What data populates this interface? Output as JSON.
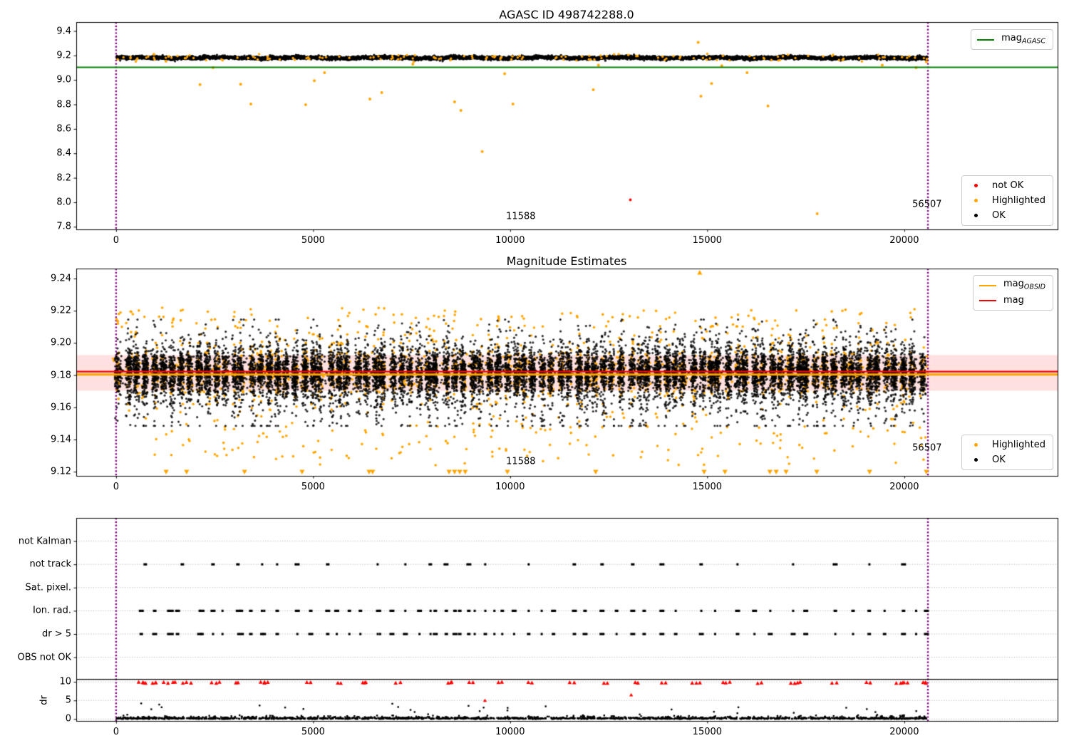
{
  "colors": {
    "ok": "#000000",
    "highlighted": "#FFA500",
    "not_ok": "#FF0000",
    "mag_agasc": "#008000",
    "mag": "#FF0000",
    "mag_obsid": "#FFA500",
    "vline": "#800080",
    "band": "rgba(255,0,0,0.12)",
    "grid": "#b5b5b5",
    "legend_border": "#cccccc"
  },
  "chart_data": [
    {
      "type": "scatter",
      "title": "AGASC ID 498742288.0",
      "xlim": [
        -1010,
        23890
      ],
      "ylim": [
        7.7785,
        9.4728
      ],
      "xticks": [
        0,
        5000,
        10000,
        15000,
        20000
      ],
      "xtick_labels": [
        "0",
        "5000",
        "10000",
        "15000",
        "20000"
      ],
      "yticks": [
        9.4,
        9.2,
        9.0,
        8.8,
        8.6,
        8.4,
        8.2,
        8.0,
        7.8
      ],
      "ytick_labels": [
        "9.4",
        "9.2",
        "9.0",
        "8.8",
        "8.6",
        "8.4",
        "8.2",
        "8.0",
        "7.8"
      ],
      "grid": false,
      "legend_top": [
        {
          "marker": "line",
          "color": "#008000",
          "label": "mag",
          "sub": "AGASC"
        }
      ],
      "legend_bottom": [
        {
          "marker": "dot",
          "color": "#FF0000",
          "label": "not OK"
        },
        {
          "marker": "dot",
          "color": "#FFA500",
          "label": "Highlighted"
        },
        {
          "marker": "dot",
          "color": "#000000",
          "label": "OK"
        }
      ],
      "mag_agasc_line": {
        "y": 9.103,
        "color": "#008000"
      },
      "vlines": [
        0,
        20600
      ],
      "annotations": [
        {
          "text": "11588",
          "x": 10271,
          "y": 7.885
        },
        {
          "text": "56507",
          "x": 20578,
          "y": 7.983
        }
      ],
      "ok_series": {
        "label": "OK",
        "color": "#000000",
        "n": 6500,
        "x_range": [
          20,
          20580
        ],
        "mean": 9.181,
        "sd": 0.0068,
        "clip": [
          9.153,
          9.212
        ]
      },
      "highlighted_series": {
        "label": "Highlighted",
        "color": "#FFA500",
        "n_band": 150,
        "band_sd": 0.013,
        "outliers": [
          [
            960,
            9.21
          ],
          [
            1266,
            9.152
          ],
          [
            2130,
            8.962
          ],
          [
            3160,
            8.965
          ],
          [
            3420,
            8.803
          ],
          [
            4810,
            8.797
          ],
          [
            5030,
            8.994
          ],
          [
            6440,
            8.844
          ],
          [
            6740,
            8.896
          ],
          [
            8590,
            8.82
          ],
          [
            8750,
            8.751
          ],
          [
            9290,
            8.415
          ],
          [
            10070,
            8.803
          ],
          [
            12110,
            8.919
          ],
          [
            14770,
            9.307
          ],
          [
            14840,
            8.867
          ],
          [
            15110,
            8.971
          ],
          [
            15370,
            9.116
          ],
          [
            16540,
            8.787
          ],
          [
            17790,
            7.906
          ],
          [
            2460,
            9.1
          ],
          [
            5290,
            9.06
          ],
          [
            7530,
            9.13
          ],
          [
            9860,
            9.05
          ],
          [
            12240,
            9.12
          ],
          [
            16010,
            9.06
          ],
          [
            19440,
            9.12
          ],
          [
            20300,
            9.1
          ],
          [
            20560,
            9.148
          ]
        ]
      },
      "not_ok_series": {
        "label": "not OK",
        "color": "#FF0000",
        "points": [
          [
            13050,
            8.02
          ]
        ]
      }
    },
    {
      "type": "scatter",
      "title": "Magnitude Estimates",
      "xlim": [
        -1010,
        23890
      ],
      "ylim": [
        9.1174,
        9.2462
      ],
      "xticks": [
        0,
        5000,
        10000,
        15000,
        20000
      ],
      "xtick_labels": [
        "0",
        "5000",
        "10000",
        "15000",
        "20000"
      ],
      "yticks": [
        9.24,
        9.22,
        9.2,
        9.18,
        9.16,
        9.14,
        9.12
      ],
      "ytick_labels": [
        "9.24",
        "9.22",
        "9.20",
        "9.18",
        "9.16",
        "9.14",
        "9.12"
      ],
      "band": {
        "y0": 9.1703,
        "y1": 9.1925,
        "color": "rgba(255,0,0,0.12)"
      },
      "mag_line": {
        "y": 9.1822,
        "color": "#FF0000"
      },
      "mag_obsid_line": {
        "y": 9.1804,
        "color": "#FFA500"
      },
      "vlines": [
        0,
        20600
      ],
      "legend_top": [
        {
          "marker": "line",
          "color": "#FFA500",
          "label": "mag",
          "sub": "OBSID"
        },
        {
          "marker": "line",
          "color": "#FF0000",
          "label": "mag"
        }
      ],
      "legend_bottom": [
        {
          "marker": "dot",
          "color": "#FFA500",
          "label": "Highlighted"
        },
        {
          "marker": "dot",
          "color": "#000000",
          "label": "OK"
        }
      ],
      "annotations": [
        {
          "text": "11588",
          "x": 10271,
          "y": 9.1264
        },
        {
          "text": "56507",
          "x": 20578,
          "y": 9.1348
        }
      ],
      "clusters": {
        "count": 92,
        "x_start": 60,
        "x_spacing": 224,
        "x_jitter": 90,
        "x_sd": 45,
        "black_per_cluster": 120,
        "orange_per_cluster": 30,
        "mean": 9.1815,
        "core_sd": 0.0062,
        "tail_sd": 0.013,
        "clip": [
          9.1485,
          9.2145
        ]
      },
      "scatter_fill": {
        "n": 1200,
        "sd": 0.009
      },
      "clipped_bottom_x": [
        1270,
        1790,
        3260,
        4720,
        6420,
        6510,
        8450,
        8590,
        8720,
        8860,
        9930,
        12170,
        14920,
        15450,
        16590,
        16750,
        17000,
        17780,
        19120,
        20560
      ],
      "clipped_top_x": [
        14810
      ]
    },
    {
      "type": "scatter",
      "title": "",
      "xlim": [
        -1010,
        23890
      ],
      "xticks": [
        0,
        5000,
        10000,
        15000,
        20000
      ],
      "xtick_labels": [
        "0",
        "5000",
        "10000",
        "15000",
        "20000"
      ],
      "rows": [
        "not Kalman",
        "not track",
        "Sat. pixel.",
        "Ion. rad.",
        "dr > 5",
        "OBS not OK"
      ],
      "row_points": {
        "not Kalman": [],
        "not track": [
          741,
          1682,
          2459,
          3092,
          3707,
          4087,
          4593,
          5371,
          6637,
          7341,
          7974,
          8372,
          8951,
          9367,
          10470,
          11627,
          12332,
          13110,
          13851,
          14846,
          15768,
          17179,
          18246,
          19114,
          19982
        ],
        "Sat. pixel.": [],
        "Ion. rad.": [
          640,
          980,
          1320,
          1400,
          1560,
          2120,
          2180,
          2460,
          2700,
          3100,
          3180,
          3420,
          3700,
          3760,
          4090,
          4600,
          4940,
          5370,
          5600,
          5920,
          6200,
          6640,
          6700,
          7000,
          7340,
          7700,
          7980,
          8100,
          8380,
          8600,
          8720,
          8950,
          9100,
          9370,
          9600,
          9800,
          10100,
          10470,
          10800,
          11100,
          11630,
          11900,
          12330,
          12700,
          13110,
          13400,
          13850,
          14200,
          14850,
          15200,
          15770,
          16200,
          16600,
          17180,
          17500,
          18250,
          18700,
          19110,
          19500,
          19980,
          20300,
          20560
        ],
        "dr > 5": [
          640,
          980,
          1320,
          1400,
          1560,
          2120,
          2180,
          2460,
          2700,
          3100,
          3180,
          3420,
          3700,
          3760,
          4090,
          4600,
          4940,
          5370,
          5600,
          5920,
          6200,
          6640,
          6700,
          7000,
          7340,
          7700,
          7980,
          8100,
          8380,
          8600,
          8720,
          8950,
          9100,
          9370,
          9600,
          9800,
          10100,
          10470,
          10800,
          11100,
          11630,
          11900,
          12330,
          12700,
          13110,
          13400,
          13850,
          14200,
          14850,
          15200,
          15770,
          16200,
          16600,
          17180,
          17500,
          18250,
          18700,
          19110,
          19500,
          19980,
          20300,
          20560
        ],
        "OBS not OK": []
      },
      "dr_axis": {
        "label": "dr",
        "ticks": [
          10,
          5,
          0
        ],
        "tick_labels": [
          "10",
          "5",
          "0"
        ],
        "threshold_line_y": 10.7,
        "red_clipped_y": 9.8,
        "red_clipped_x": [
          600,
          690,
          920,
          1010,
          1210,
          1300,
          1430,
          1720,
          1810,
          2440,
          2530,
          3020,
          3110,
          3670,
          3760,
          4830,
          4920,
          5620,
          5710,
          6240,
          6330,
          7110,
          7200,
          8410,
          8500,
          8950,
          9040,
          9710,
          9800,
          10470,
          10560,
          11520,
          11610,
          12390,
          12480,
          13150,
          13240,
          13870,
          13960,
          14630,
          14720,
          15390,
          15480,
          16260,
          16350,
          17120,
          17210,
          17300,
          18170,
          18260,
          19040,
          19130,
          19800,
          19890,
          19980,
          20470,
          20560
        ],
        "red_points": [
          [
            9360,
            5.0
          ],
          [
            13070,
            6.5
          ]
        ],
        "ok_points": {
          "n": 1700,
          "y_sd": 0.42,
          "spike_n": 26,
          "spike_y_min": 1.5,
          "spike_y_max": 4.3
        }
      },
      "vlines": [
        0,
        20600
      ]
    }
  ]
}
